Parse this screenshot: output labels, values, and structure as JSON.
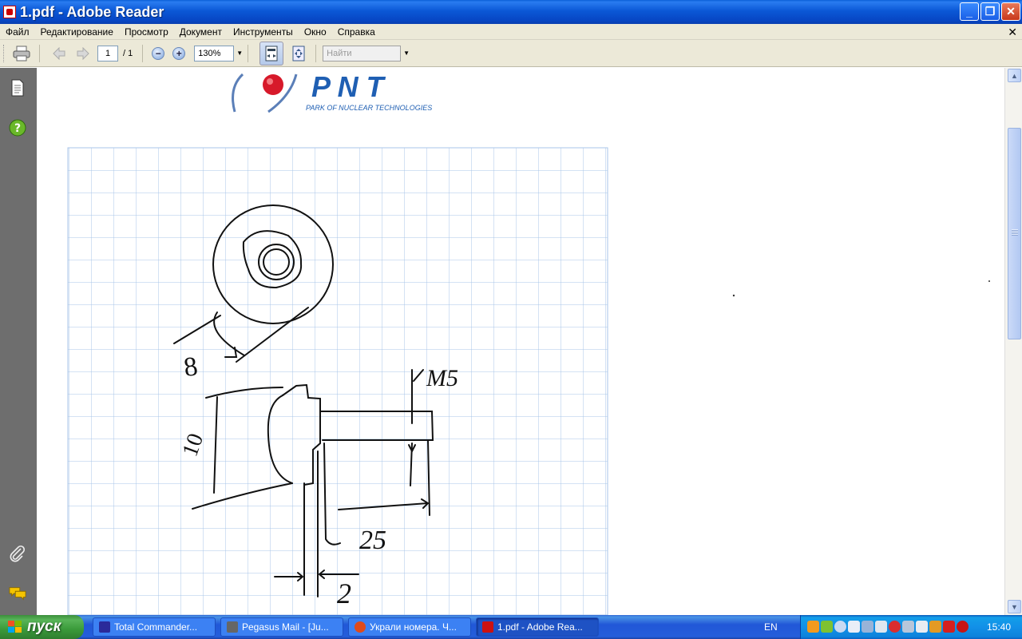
{
  "window": {
    "title": "1.pdf - Adobe Reader"
  },
  "menu": [
    "Файл",
    "Редактирование",
    "Просмотр",
    "Документ",
    "Инструменты",
    "Окно",
    "Справка"
  ],
  "toolbar": {
    "page_current": "1",
    "page_total": "/ 1",
    "zoom": "130%",
    "find_placeholder": "Найти"
  },
  "document": {
    "logo": {
      "text": "P N T",
      "subtitle": "PARK OF NUCLEAR TECHNOLOGIES"
    },
    "sketch_labels": {
      "diameter": "8",
      "thread": "M5",
      "height": "10",
      "length": "25",
      "thickness": "2"
    }
  },
  "taskbar": {
    "start_label": "пуск",
    "tasks": [
      {
        "label": "Total Commander...",
        "icon_color": "#2a2a9a"
      },
      {
        "label": "Pegasus Mail - [Ju...",
        "icon_color": "#666666"
      },
      {
        "label": "Украли номера. Ч...",
        "icon_color": "#e04a1a"
      },
      {
        "label": "1.pdf - Adobe Rea...",
        "icon_color": "#cc1111"
      }
    ],
    "language": "EN",
    "clock": "15:40"
  },
  "colors": {
    "titlebar": "#0b58d6",
    "taskbar": "#245edb",
    "start": "#3a9a3a",
    "grid": "#a9c6e8"
  }
}
